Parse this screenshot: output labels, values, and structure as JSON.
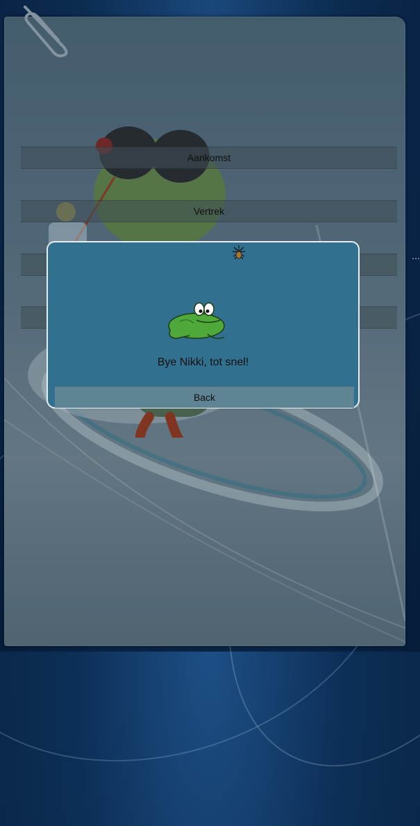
{
  "menu": {
    "items": [
      {
        "label": "Aankomst"
      },
      {
        "label": "Vertrek"
      },
      {
        "label": ""
      },
      {
        "label": ""
      }
    ]
  },
  "dialog": {
    "message": "Bye Nikki, tot snel!",
    "back_label": "Back",
    "icons": [
      "spider-icon",
      "frog-icon"
    ]
  },
  "colors": {
    "dialog_bg": "#31708f",
    "dialog_border": "#e9eef2",
    "button_bg": "#5f8493"
  }
}
